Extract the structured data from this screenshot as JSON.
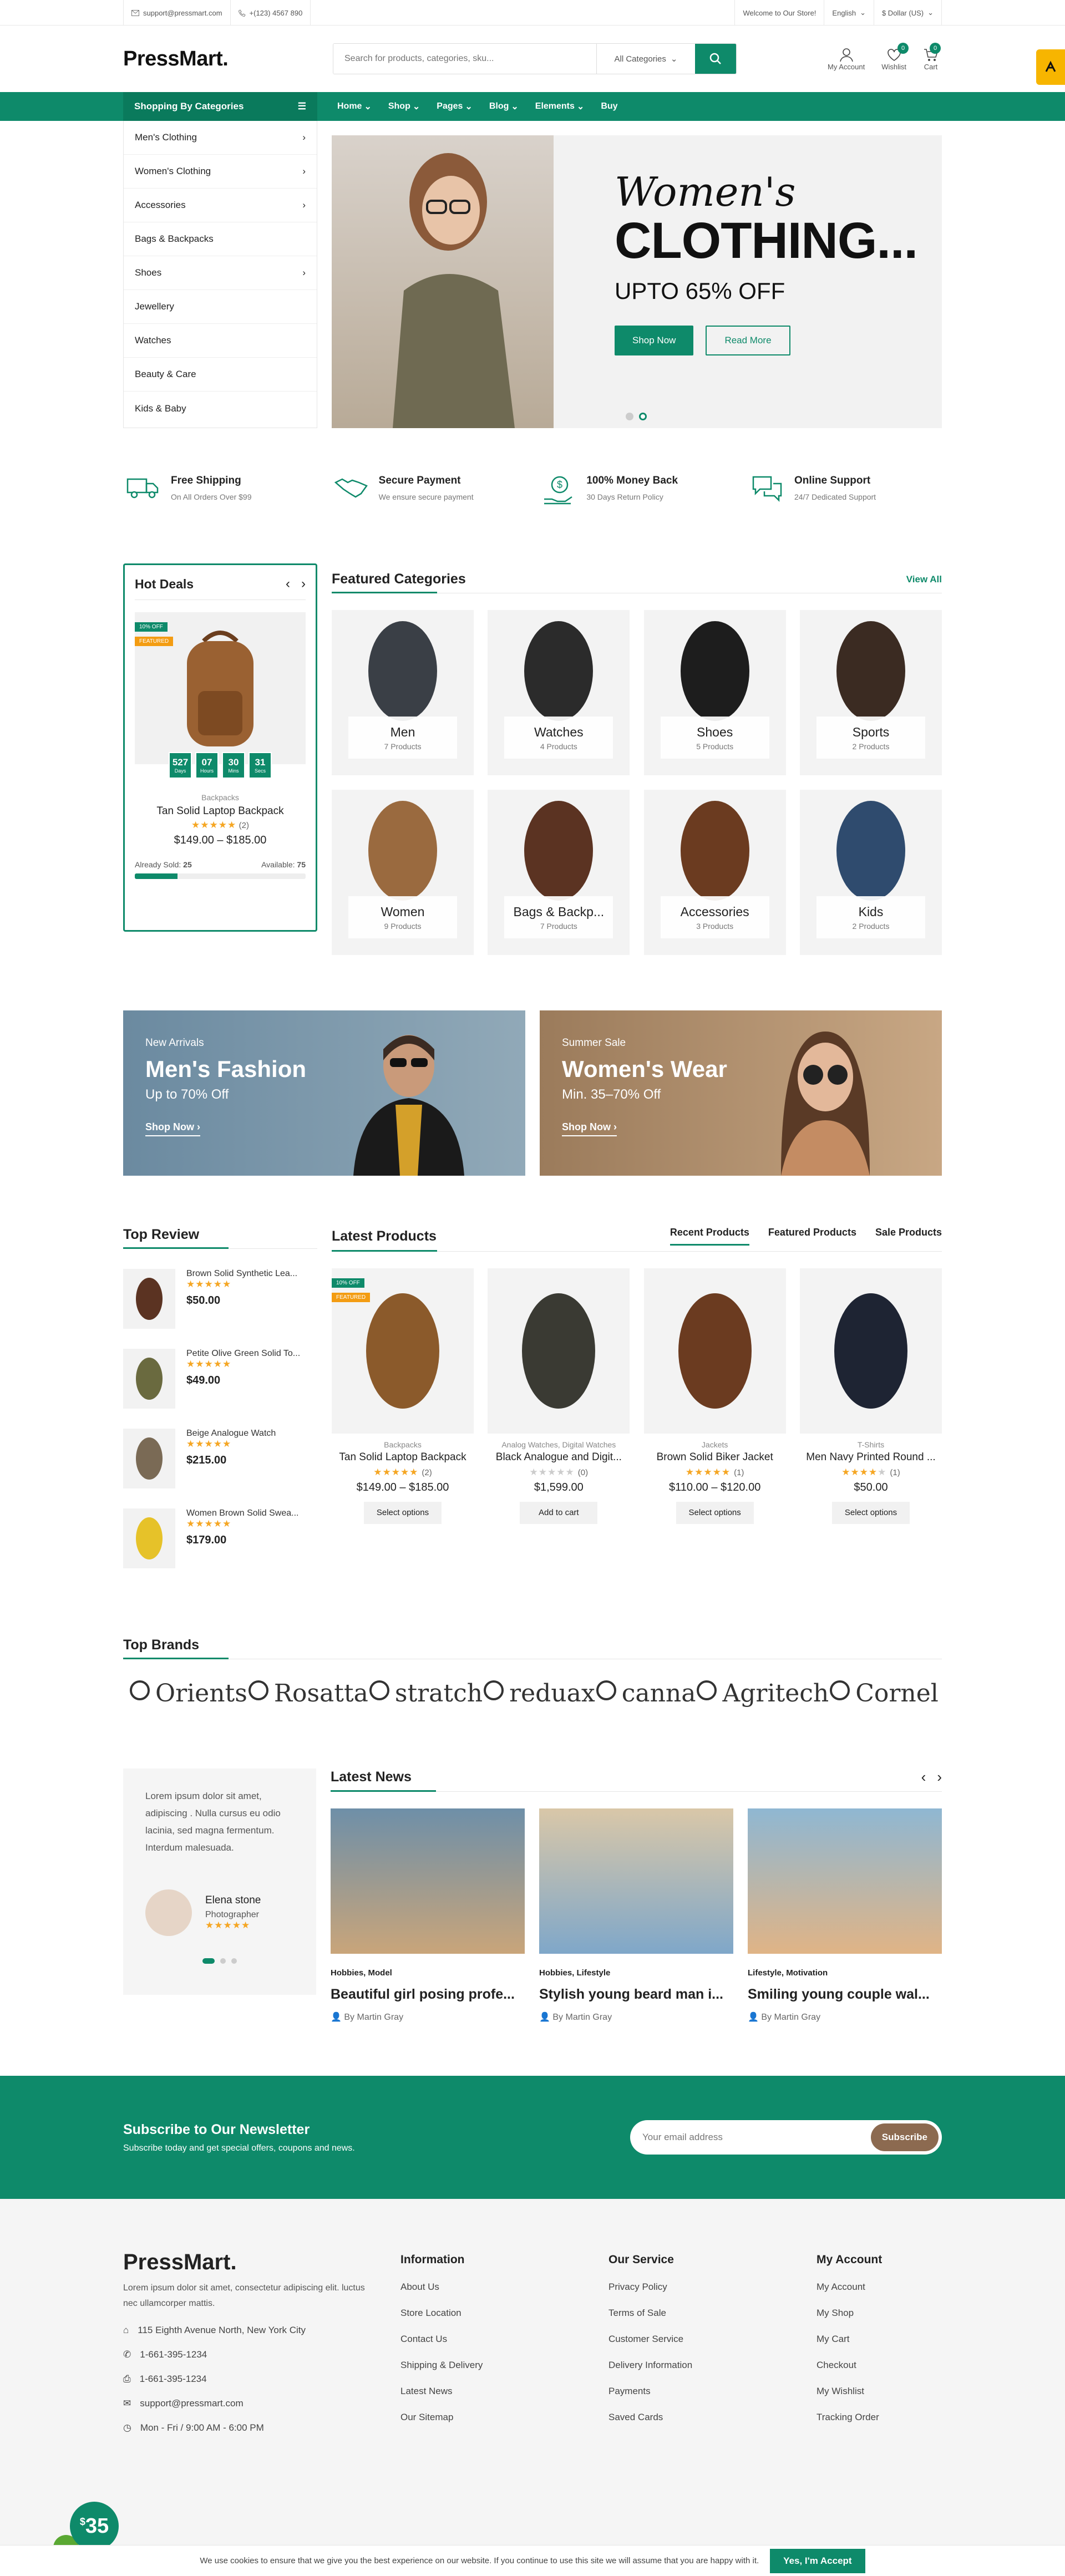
{
  "topbar": {
    "email": "support@pressmart.com",
    "phone": "+(123) 4567 890",
    "welcome": "Welcome to Our Store!",
    "language": "English",
    "currency": "$ Dollar (US)"
  },
  "header": {
    "logo": "PressMart.",
    "search_placeholder": "Search for products, categories, sku...",
    "search_category": "All Categories",
    "account_label": "My Account",
    "wishlist_label": "Wishlist",
    "wishlist_count": "0",
    "cart_label": "Cart",
    "cart_count": "0"
  },
  "nav": {
    "categories_label": "Shopping By Categories",
    "items": [
      "Home",
      "Shop",
      "Pages",
      "Blog",
      "Elements",
      "Buy"
    ]
  },
  "sidebar_categories": [
    "Men's Clothing",
    "Women's Clothing",
    "Accessories",
    "Bags & Backpacks",
    "Shoes",
    "Jewellery",
    "Watches",
    "Beauty & Care",
    "Kids & Baby"
  ],
  "hero": {
    "script": "Women's",
    "headline": "CLOTHING...",
    "sub": "UPTO 65% OFF",
    "btn_primary": "Shop Now",
    "btn_secondary": "Read More"
  },
  "features": [
    {
      "title": "Free Shipping",
      "sub": "On All Orders Over $99",
      "icon": "truck-icon"
    },
    {
      "title": "Secure Payment",
      "sub": "We ensure secure payment",
      "icon": "handshake-icon"
    },
    {
      "title": "100% Money Back",
      "sub": "30 Days Return Policy",
      "icon": "money-hand-icon"
    },
    {
      "title": "Online Support",
      "sub": "24/7 Dedicated Support",
      "icon": "chat-icon"
    }
  ],
  "hot_deals": {
    "title": "Hot Deals",
    "tag_off": "10% OFF",
    "tag_featured": "FEATURED",
    "countdown": [
      {
        "v": "527",
        "l": "Days"
      },
      {
        "v": "07",
        "l": "Hours"
      },
      {
        "v": "30",
        "l": "Mins"
      },
      {
        "v": "31",
        "l": "Secs"
      }
    ],
    "category": "Backpacks",
    "name": "Tan Solid Laptop Backpack",
    "reviews": "(2)",
    "price": "$149.00 – $185.00",
    "sold_label": "Already Sold:",
    "sold": "25",
    "available_label": "Available:",
    "available": "75",
    "sold_fraction": 0.25
  },
  "featured_categories": {
    "title": "Featured Categories",
    "view_all": "View All",
    "items": [
      {
        "name": "Men",
        "count": "7 Products",
        "color": "#3a3f46"
      },
      {
        "name": "Watches",
        "count": "4 Products",
        "color": "#2b2b2b"
      },
      {
        "name": "Shoes",
        "count": "5 Products",
        "color": "#1d1d1d"
      },
      {
        "name": "Sports",
        "count": "2 Products",
        "color": "#3b2b22"
      },
      {
        "name": "Women",
        "count": "9 Products",
        "color": "#9a6a3f"
      },
      {
        "name": "Bags & Backp...",
        "count": "7 Products",
        "color": "#5b3322"
      },
      {
        "name": "Accessories",
        "count": "3 Products",
        "color": "#6b3b20"
      },
      {
        "name": "Kids",
        "count": "2 Products",
        "color": "#2f4b6e"
      }
    ]
  },
  "banners": [
    {
      "small": "New Arrivals",
      "big": "Men's Fashion",
      "sub": "Up to 70% Off",
      "cta": "Shop Now"
    },
    {
      "small": "Summer Sale",
      "big": "Women's Wear",
      "sub": "Min. 35–70% Off",
      "cta": "Shop Now"
    }
  ],
  "top_review": {
    "title": "Top Review",
    "items": [
      {
        "name": "Brown Solid Synthetic Lea...",
        "price": "$50.00",
        "color": "#5b3322"
      },
      {
        "name": "Petite Olive Green Solid To...",
        "price": "$49.00",
        "color": "#6a6a3f"
      },
      {
        "name": "Beige Analogue Watch",
        "price": "$215.00",
        "color": "#7a6a55"
      },
      {
        "name": "Women Brown Solid Swea...",
        "price": "$179.00",
        "color": "#e6c229"
      }
    ]
  },
  "latest_products": {
    "title": "Latest Products",
    "tabs": [
      "Recent Products",
      "Featured Products",
      "Sale Products"
    ],
    "items": [
      {
        "meta": "Backpacks",
        "name": "Tan Solid Laptop Backpack",
        "reviews": "(2)",
        "rating": 5,
        "price": "$149.00 – $185.00",
        "action": "Select options",
        "color": "#8b5a2b",
        "tags": true
      },
      {
        "meta": "Analog Watches, Digital Watches",
        "name": "Black Analogue and Digit...",
        "reviews": "(0)",
        "rating": 0,
        "price": "$1,599.00",
        "action": "Add to cart",
        "color": "#3a3a33",
        "tags": false
      },
      {
        "meta": "Jackets",
        "name": "Brown Solid Biker Jacket",
        "reviews": "(1)",
        "rating": 5,
        "price": "$110.00 – $120.00",
        "action": "Select options",
        "color": "#6b3b20",
        "tags": false
      },
      {
        "meta": "T-Shirts",
        "name": "Men Navy Printed Round ...",
        "reviews": "(1)",
        "rating": 4,
        "price": "$50.00",
        "action": "Select options",
        "color": "#1e2433",
        "tags": false
      }
    ]
  },
  "brands": {
    "title": "Top Brands",
    "items": [
      "Orients",
      "Rosatta",
      "stratch",
      "reduax",
      "canna",
      "Agritech",
      "Cornel"
    ]
  },
  "testimonial": {
    "text": "Lorem ipsum dolor sit amet, adipiscing . Nulla cursus eu odio lacinia, sed magna fermentum. Interdum malesuada.",
    "name": "Elena stone",
    "role": "Photographer"
  },
  "latest_news": {
    "title": "Latest News",
    "items": [
      {
        "cat": "Hobbies, Model",
        "title": "Beautiful girl posing profe...",
        "by": "By Martin Gray"
      },
      {
        "cat": "Hobbies, Lifestyle",
        "title": "Stylish young beard man i...",
        "by": "By Martin Gray"
      },
      {
        "cat": "Lifestyle, Motivation",
        "title": "Smiling young couple wal...",
        "by": "By Martin Gray"
      }
    ]
  },
  "newsletter": {
    "title": "Subscribe to Our Newsletter",
    "sub": "Subscribe today and get special offers, coupons and news.",
    "placeholder": "Your email address",
    "button": "Subscribe"
  },
  "footer": {
    "logo": "PressMart.",
    "desc": "Lorem ipsum dolor sit amet, consectetur adipiscing elit. luctus nec ullamcorper mattis.",
    "address": "115 Eighth Avenue North, New York City",
    "phone": "1-661-395-1234",
    "fax": "1-661-395-1234",
    "email": "support@pressmart.com",
    "hours": "Mon - Fri / 9:00 AM - 6:00 PM",
    "columns": [
      {
        "title": "Information",
        "links": [
          "About Us",
          "Store Location",
          "Contact Us",
          "Shipping & Delivery",
          "Latest News",
          "Our Sitemap"
        ]
      },
      {
        "title": "Our Service",
        "links": [
          "Privacy Policy",
          "Terms of Sale",
          "Customer Service",
          "Delivery Information",
          "Payments",
          "Saved Cards"
        ]
      },
      {
        "title": "My Account",
        "links": [
          "My Account",
          "My Shop",
          "My Cart",
          "Checkout",
          "My Wishlist",
          "Tracking Order"
        ]
      }
    ]
  },
  "cookie": {
    "text": "We use cookies to ensure that we give you the best experience on our website. If you continue to use this site we will assume that you are happy with it.",
    "button": "Yes, I'm Accept"
  },
  "promo_badge": {
    "currency": "$",
    "value": "35"
  }
}
